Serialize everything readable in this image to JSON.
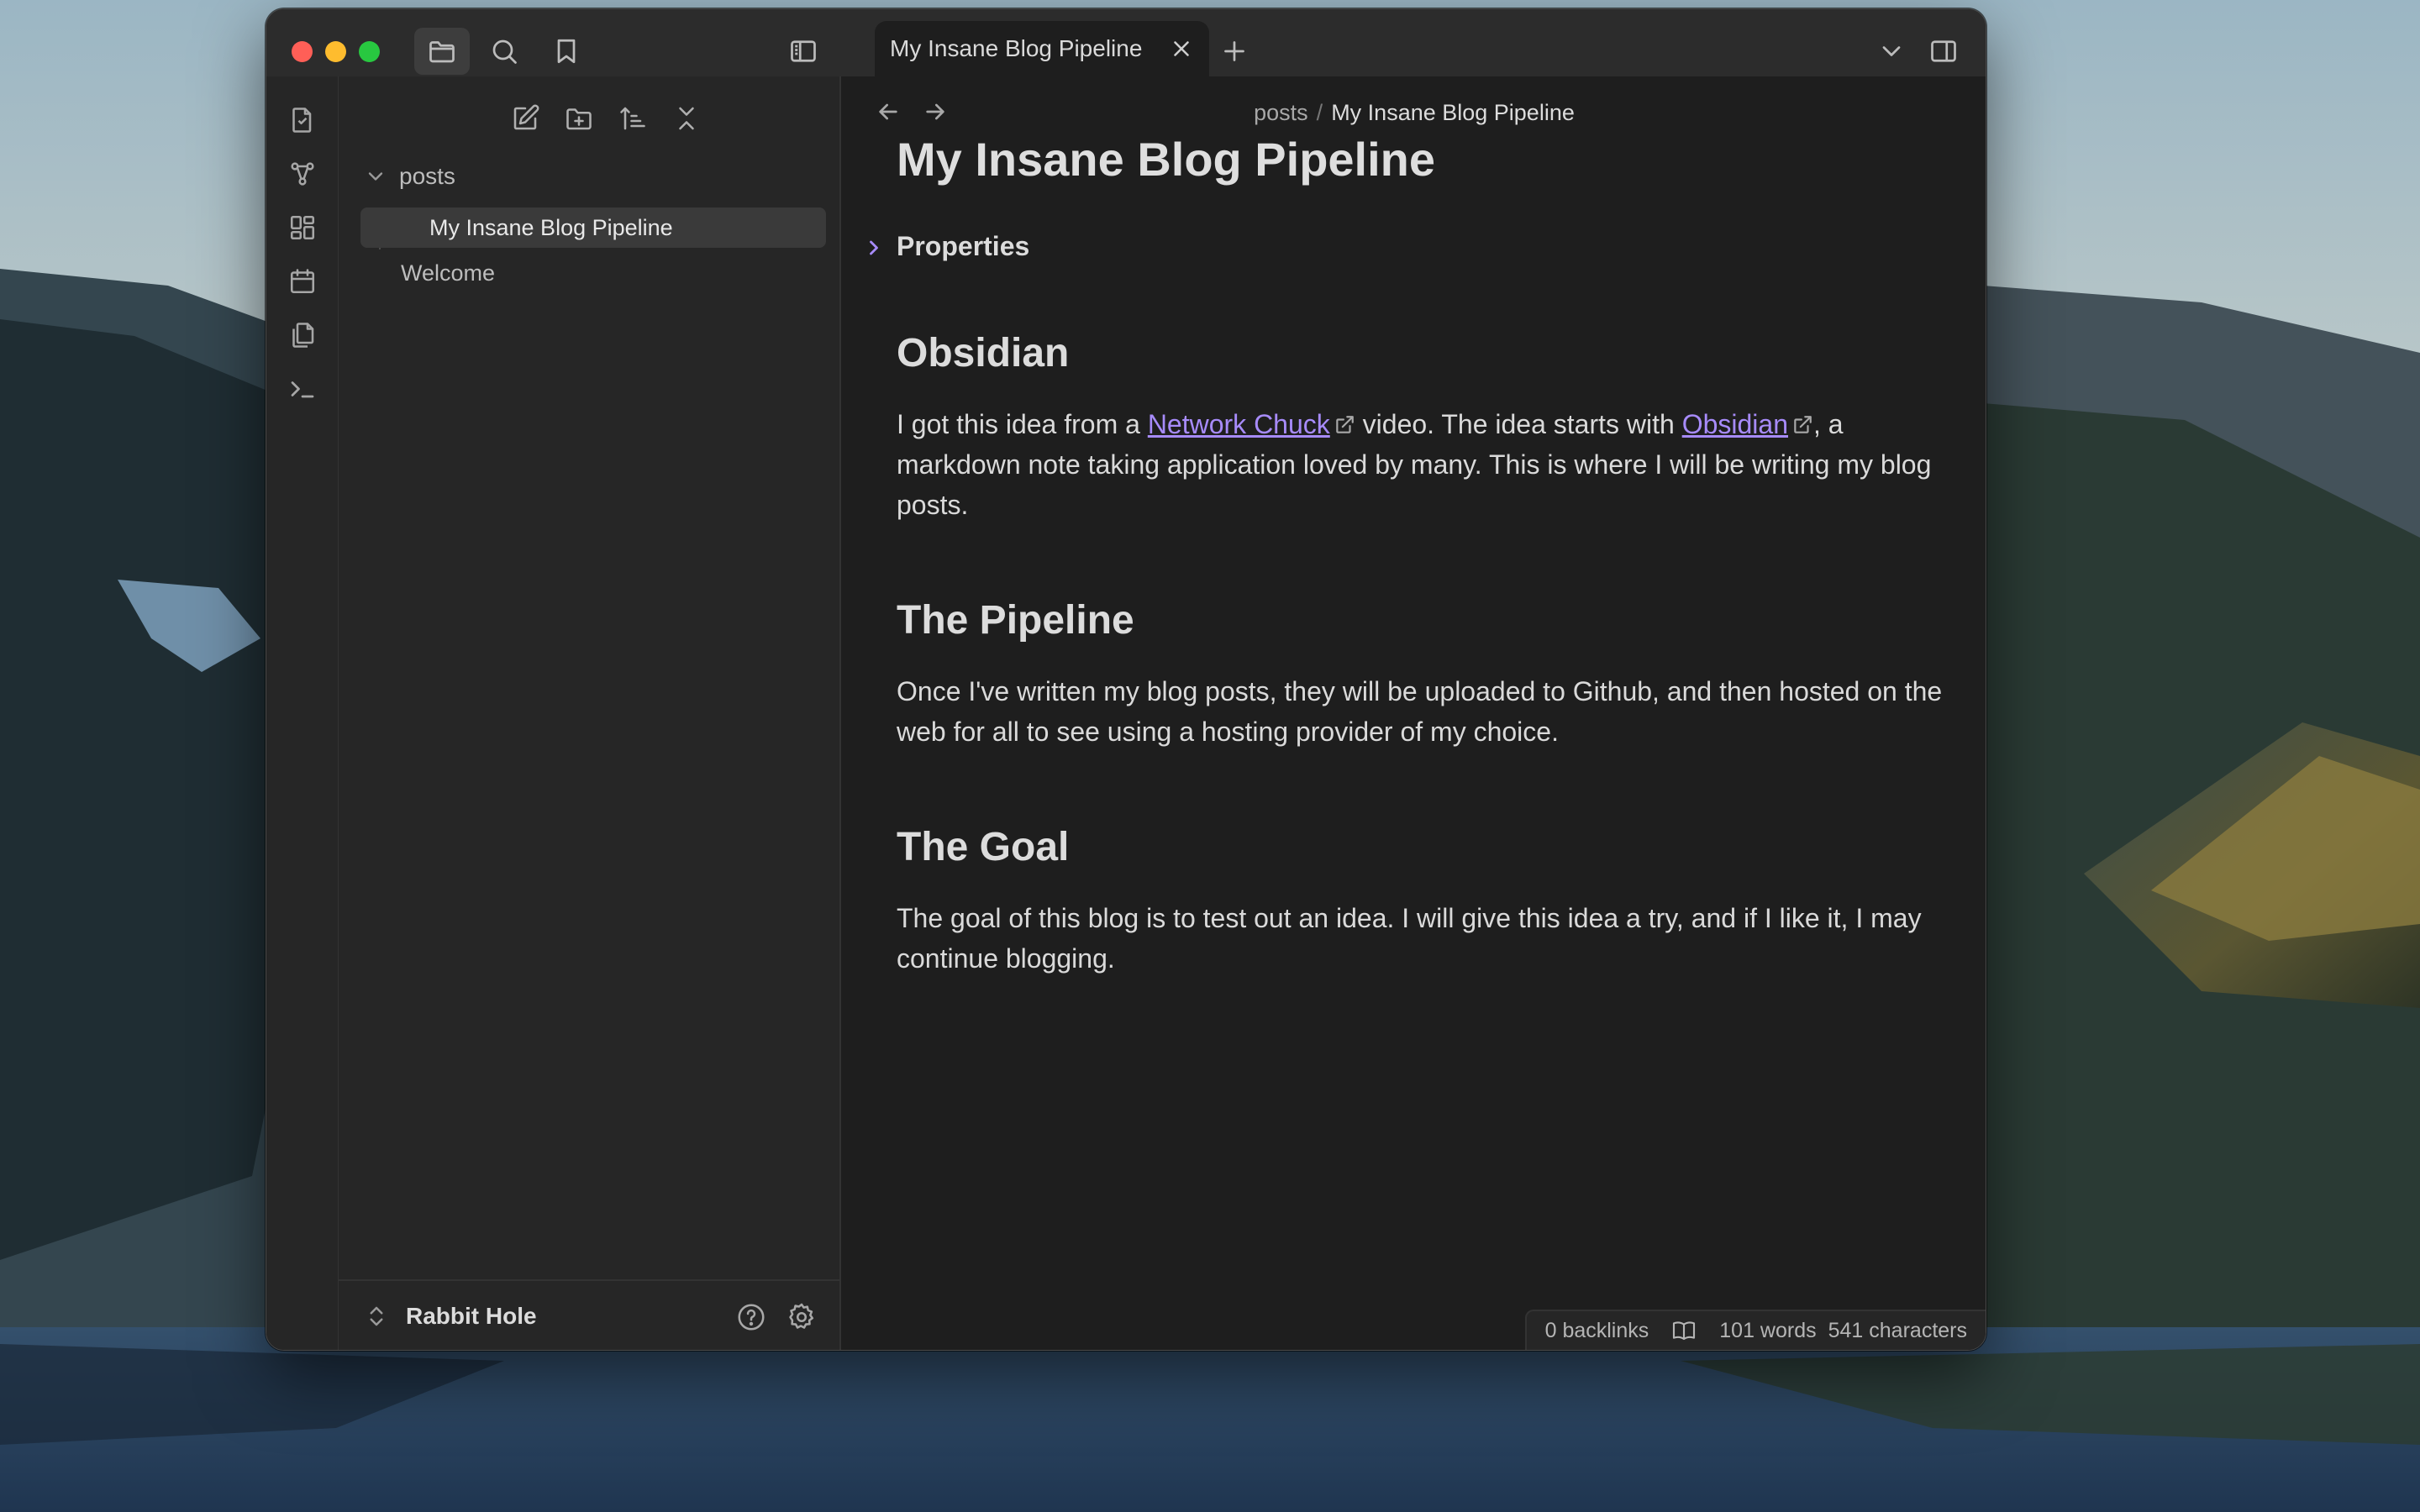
{
  "window": {
    "tab_title": "My Insane Blog Pipeline"
  },
  "titlebar": {
    "icons": [
      "folder-icon",
      "search-icon",
      "bookmark-icon",
      "sidebar-toggle-icon",
      "close-icon",
      "plus-icon",
      "chevron-down-icon",
      "right-sidebar-icon"
    ]
  },
  "ribbon": {
    "icons": [
      "open-quick-switcher-icon",
      "graph-view-icon",
      "canvas-icon",
      "daily-note-icon",
      "templates-icon",
      "command-palette-icon"
    ]
  },
  "sidebar": {
    "toolbar_icons": [
      "new-note-icon",
      "new-folder-icon",
      "sort-icon",
      "collapse-all-icon"
    ],
    "tree": {
      "folder": "posts",
      "files": [
        "My Insane Blog Pipeline",
        "Welcome"
      ]
    },
    "vault_name": "Rabbit Hole"
  },
  "breadcrumb": {
    "folder": "posts",
    "separator": "/",
    "current": "My Insane Blog Pipeline"
  },
  "document": {
    "title": "My Insane Blog Pipeline",
    "properties_label": "Properties",
    "sections": [
      {
        "heading": "Obsidian",
        "text_before_link1": "I got this idea from a ",
        "link1": "Network Chuck",
        "text_between": " video. The idea starts with ",
        "link2": "Obsidian",
        "text_after": ", a markdown note taking application loved by many. This is where I will be writing my blog posts."
      },
      {
        "heading": "The Pipeline",
        "text": "Once I've written my blog posts, they will be uploaded to Github, and then hosted on the web for all to see using a hosting provider of my choice."
      },
      {
        "heading": "The Goal",
        "text": "The goal of this blog is to test out an idea. I will give this idea a try, and if I like it, I may continue blogging."
      }
    ]
  },
  "statusbar": {
    "backlinks": "0 backlinks",
    "words": "101 words",
    "characters": "541 characters"
  },
  "colors": {
    "accent": "#a78bfa",
    "background": "#1e1e1e",
    "sidebar": "#262626"
  }
}
